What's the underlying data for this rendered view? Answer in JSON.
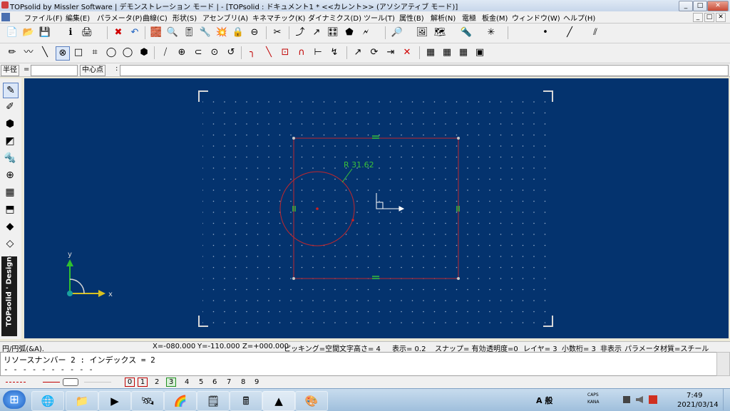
{
  "window": {
    "title": "TOPsolid by Missler Software | デモンストレーション モード | - [TOPsolid : ドキュメント1 * <<カレント>> (アソシアティブ モード)]",
    "controls": [
      "_",
      "□",
      "✕"
    ]
  },
  "menu": [
    "ファイル(F)",
    "編集(E)",
    "パラメータ(P)",
    "曲線(C)",
    "形状(S)",
    "アセンブリ(A)",
    "キネマチック(K)",
    "ダイナミクス(D)",
    "ツール(T)",
    "属性(B)",
    "解析(N)",
    "電極",
    "板金(M)",
    "ウィンドウ(W)",
    "ヘルプ(H)"
  ],
  "toolbar1": [
    "📄",
    "📂",
    "💾",
    "ℹ",
    "🖨",
    "✖",
    "↶",
    "🧱",
    "🔍",
    "🎚",
    "🔧",
    "💥",
    "🔒",
    "⊖",
    "✂",
    "⤴",
    "↗",
    "🎛",
    "⬟",
    "🗲",
    "🔎",
    "🖼",
    "🗺",
    "🔦",
    "✳"
  ],
  "toolbar2": [
    "✏",
    "〰",
    "╲",
    "⊗",
    "□",
    "⌗",
    "◯",
    "◯",
    "⬢",
    "⧸",
    "⊕",
    "⊂",
    "⊙",
    "↺",
    "╮",
    "╲",
    "⊡",
    "∩",
    "⊢",
    "↯",
    "↗",
    "⟳",
    "⇥",
    "✕",
    "▦",
    "▦",
    "▦",
    "▣"
  ],
  "line_style_dot": "•",
  "line_style_line": "╱",
  "line_style_hatch": "⫽",
  "current_color": "#e00000",
  "input": {
    "radius_label": "半径",
    "radius_eq": "=",
    "center_label": "中心点",
    "center_sep": ":"
  },
  "lefttools": [
    "✎",
    "✐",
    "⬢",
    "◩",
    "🔩",
    "⊕",
    "▦",
    "⬒",
    "◆",
    "◇",
    "⬡",
    "⌂"
  ],
  "brand": "TOPsolid ' Design",
  "viewport": {
    "dimension_label": "R 31.62",
    "axis_x_label": "x",
    "axis_y_label": "y"
  },
  "status": {
    "command": "円/円弧(&A).",
    "x": "X=-080.000",
    "y": "Y=-110.000",
    "z": "Z=+000.000",
    "picking": "ピッキング=空間",
    "text_height": "文字高さ=  4",
    "display": "表示=  0.2",
    "snap": "スナップ= 有効",
    "transparency": "透明度=0",
    "layer": "レイヤ=  3",
    "decimals": "小数桁= 3",
    "hidden": "非表示",
    "param": "パラメータ",
    "material": "材質=スチール"
  },
  "message": {
    "line1": "リソースナンバー 2 : インデックス = 2",
    "line2": "- - - - - - - - - -"
  },
  "stylebar": {
    "layers": [
      "0",
      "1",
      "2",
      "3",
      "4",
      "5",
      "6",
      "7",
      "8",
      "9"
    ]
  },
  "taskbar": {
    "start": "⊞",
    "apps": [
      "🌐",
      "📁",
      "▶",
      "🛰",
      "🌈",
      "🗒",
      "🖩",
      "▲",
      "🎨"
    ],
    "ime": "A 般",
    "caps": "CAPS",
    "kana": "KANA",
    "time": "7:49",
    "date": "2021/03/14"
  }
}
